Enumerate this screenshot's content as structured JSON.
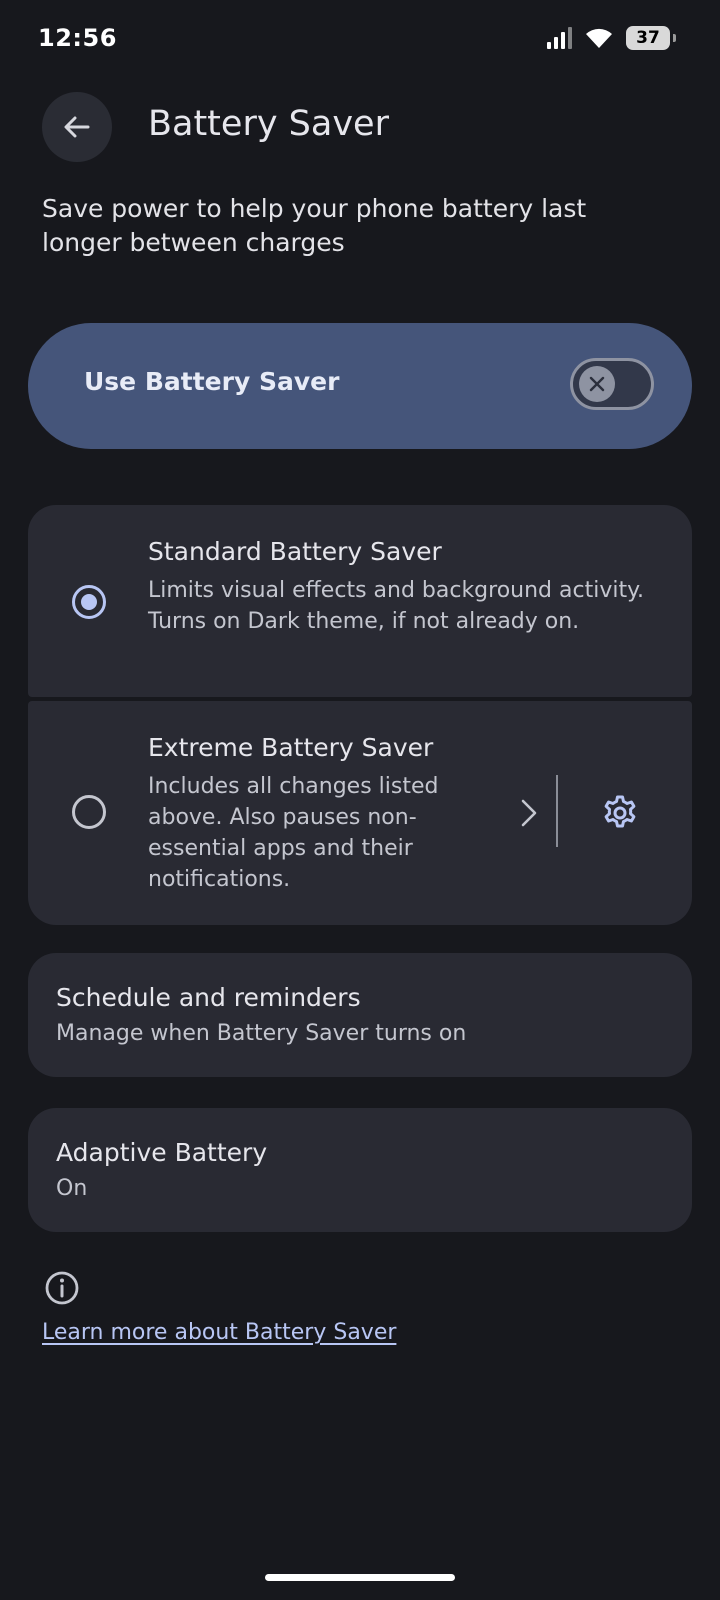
{
  "status_bar": {
    "time": "12:56",
    "battery_level": "37",
    "icons": [
      "signal-icon",
      "wifi-icon",
      "battery-icon"
    ]
  },
  "header": {
    "back_icon": "arrow-left-icon",
    "title": "Battery Saver"
  },
  "description": "Save power to help your phone battery last longer between charges",
  "main_toggle": {
    "label": "Use Battery Saver",
    "state": "off"
  },
  "options": [
    {
      "title": "Standard Battery Saver",
      "description": "Limits visual effects and background activity. Turns on Dark theme, if not already on.",
      "selected": true
    },
    {
      "title": "Extreme Battery Saver",
      "description": "Includes all changes listed above. Also pauses non-essential apps and their notifications.",
      "selected": false,
      "icons": [
        "chevron-right-icon",
        "gear-icon"
      ]
    }
  ],
  "schedule": {
    "title": "Schedule and reminders",
    "subtitle": "Manage when Battery Saver turns on"
  },
  "adaptive": {
    "title": "Adaptive Battery",
    "subtitle": "On"
  },
  "footer": {
    "info_icon": "info-icon",
    "link_text": "Learn more about Battery Saver"
  },
  "colors": {
    "background": "#17181d",
    "card": "#292a33",
    "toggle_card": "#45557a",
    "accent": "#b8c6f4"
  }
}
